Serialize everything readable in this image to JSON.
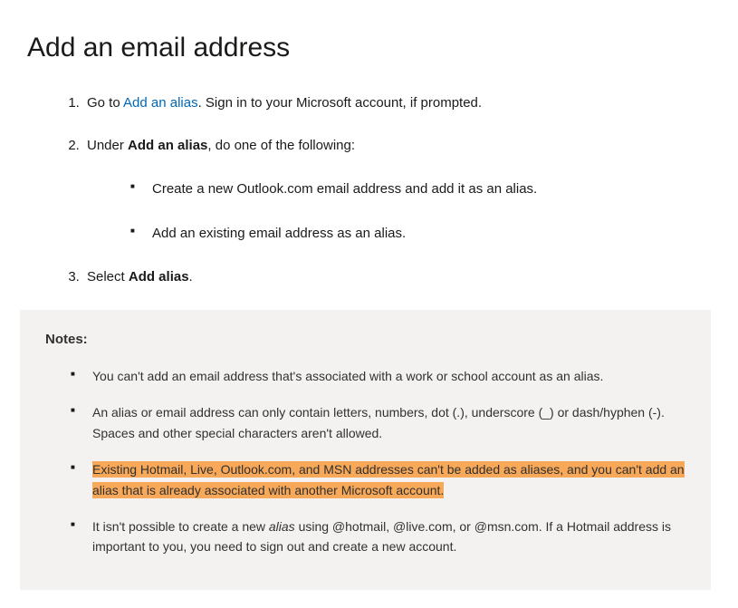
{
  "heading": "Add an email address",
  "steps": {
    "s1": {
      "prefix": "Go to ",
      "link": "Add an alias",
      "suffix": ". Sign in to your Microsoft account, if prompted."
    },
    "s2": {
      "prefix": "Under ",
      "bold": "Add an alias",
      "suffix": ", do one of the following:",
      "sub1": "Create a new Outlook.com email address and add it as an alias.",
      "sub2": "Add an existing email address as an alias."
    },
    "s3": {
      "prefix": "Select ",
      "bold": "Add alias",
      "suffix": "."
    }
  },
  "notes": {
    "title": "Notes:",
    "n1": "You can't add an email address that's associated with a work or school account as an alias.",
    "n2": "An alias or email address can only contain letters, numbers, dot (.), underscore (_) or dash/hyphen (-). Spaces and other special characters aren't allowed.",
    "n3": "Existing Hotmail, Live, Outlook.com, and MSN addresses can't be added as aliases, and you can't add an alias that is already associated with another Microsoft account.",
    "n4a": "It isn't possible to create a new ",
    "n4b": "alias",
    "n4c": " using @hotmail, @live.com, or @msn.com. If a Hotmail address is important to you, you need to sign out and create a new account."
  }
}
